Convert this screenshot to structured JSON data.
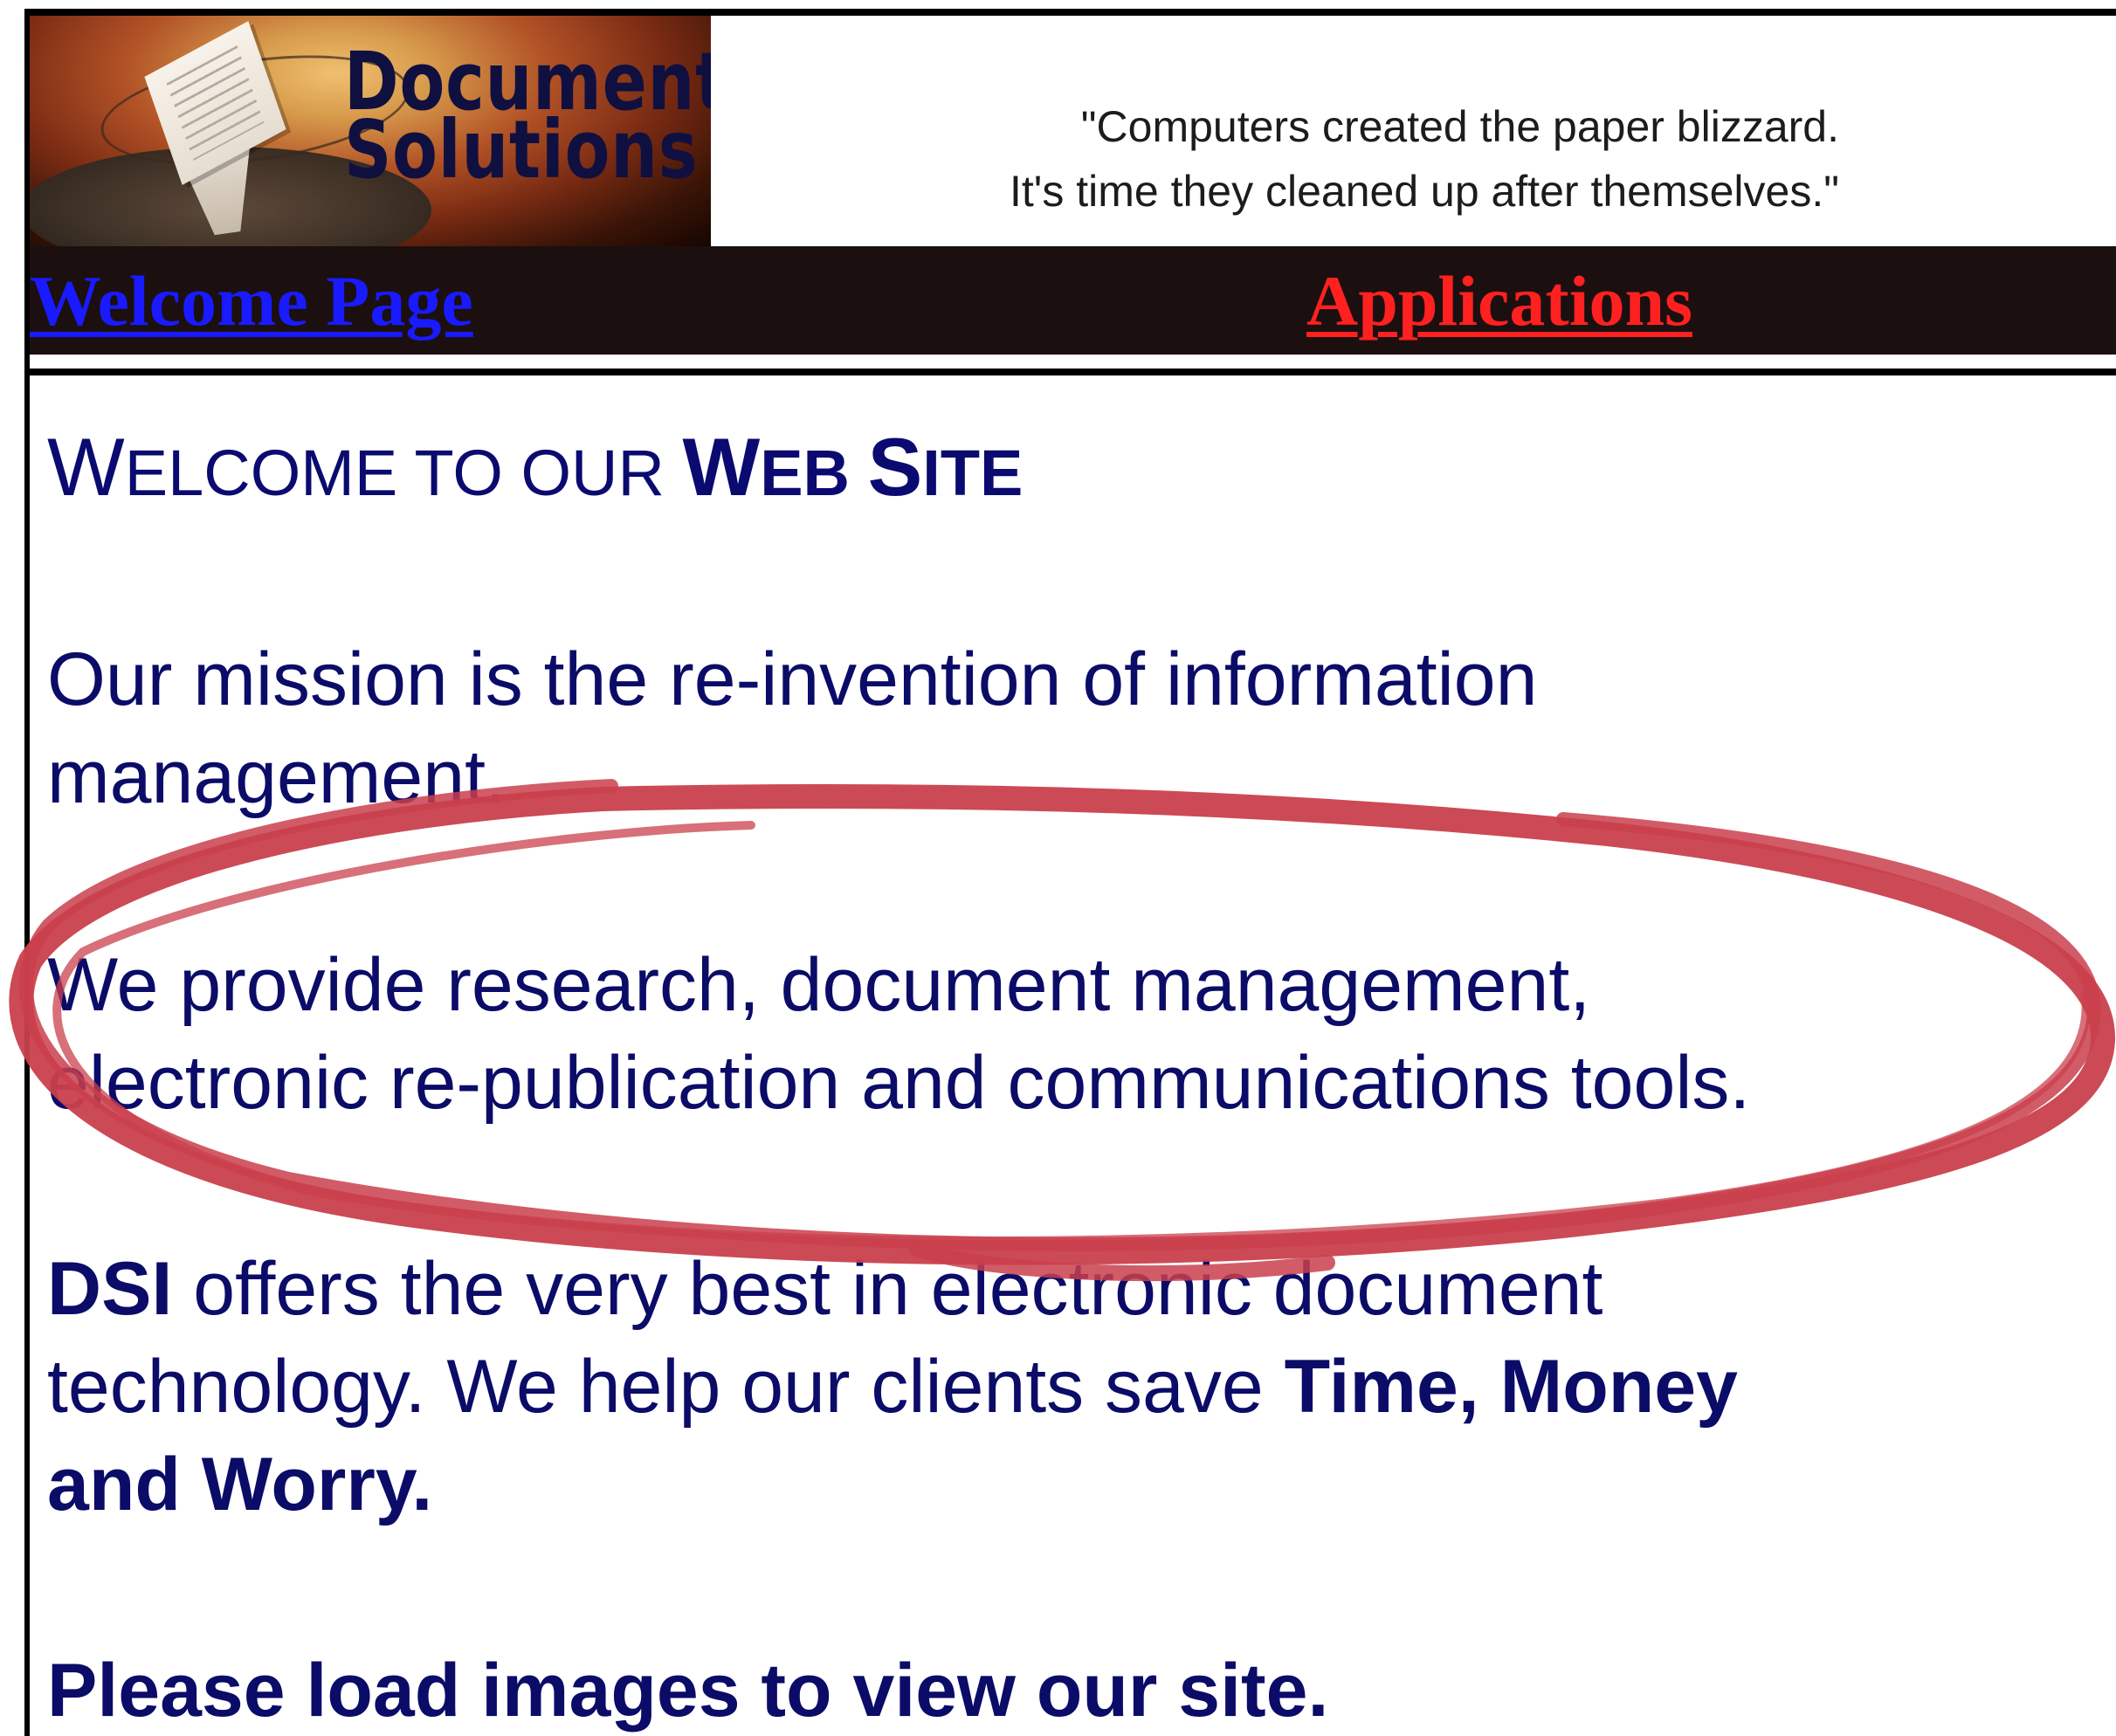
{
  "header": {
    "logo_line_1": "Document",
    "logo_line_2": "Solutions",
    "tagline_line_1": "\"Computers created the paper blizzard.",
    "tagline_line_2": "It's time they cleaned up after themselves.\""
  },
  "nav": {
    "welcome_label": "Welcome Page",
    "applications_label": "Applications"
  },
  "main": {
    "heading_part_1_big": "W",
    "heading_part_1_small": "ELCOME TO OUR ",
    "heading_part_2_big": "W",
    "heading_part_2_small": "EB ",
    "heading_part_3_big": "S",
    "heading_part_3_small": "ITE",
    "mission_line_1": "Our mission is the re-invention of information",
    "mission_line_2": "management.",
    "provide_line_1": "We provide research, document management,",
    "provide_line_2": "electronic re-publication and communications tools.",
    "dsi_bold": "DSI",
    "dsi_rest_line_1": " offers the very best in electronic document",
    "dsi_line_2_regular": "technology. We  help our clients save ",
    "dsi_line_2_bold": "Time, Money",
    "dsi_line_3_bold": "and Worry.",
    "load_images": "Please load images to view our site."
  },
  "colors": {
    "nav_background": "#1b0f10",
    "welcome_link": "#1a1aff",
    "applications_link": "#ff2020",
    "body_text": "#0b0b68",
    "annotation_circle": "#c9404c"
  }
}
